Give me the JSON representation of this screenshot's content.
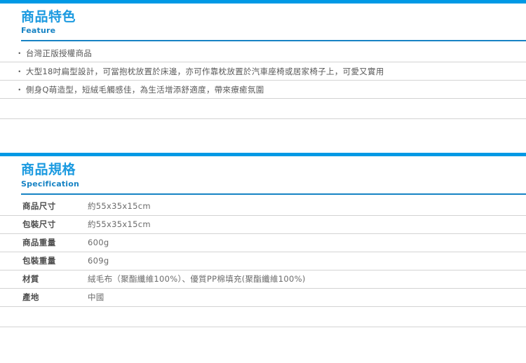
{
  "colors": {
    "accent_bar": "#0099e5",
    "title_zh": "#1b9ae0",
    "title_en": "#1783c4",
    "rule": "#1783c4",
    "row_separator": "#d3d3d3",
    "body_text": "#595959"
  },
  "feature_section": {
    "title_zh": "商品特色",
    "title_en": "Feature",
    "bullet_symbol": "・",
    "items": [
      "台灣正版授權商品",
      "大型18吋扁型設計，可當抱枕放置於床邊，亦可作靠枕放置於汽車座椅或居家椅子上，可愛又實用",
      "側身Q萌造型，短絨毛觸感佳，為生活增添舒適度，帶來療癒氛圍"
    ]
  },
  "spec_section": {
    "title_zh": "商品規格",
    "title_en": "Specification",
    "rows": [
      {
        "label": "商品尺寸",
        "value": "約55x35x15cm"
      },
      {
        "label": "包裝尺寸",
        "value": "約55x35x15cm"
      },
      {
        "label": "商品重量",
        "value": "600g"
      },
      {
        "label": "包裝重量",
        "value": "609g"
      },
      {
        "label": "材質",
        "value": "絨毛布（聚酯纖維100%）、優質PP棉填充(聚酯纖維100%)"
      },
      {
        "label": "產地",
        "value": "中國"
      }
    ]
  }
}
